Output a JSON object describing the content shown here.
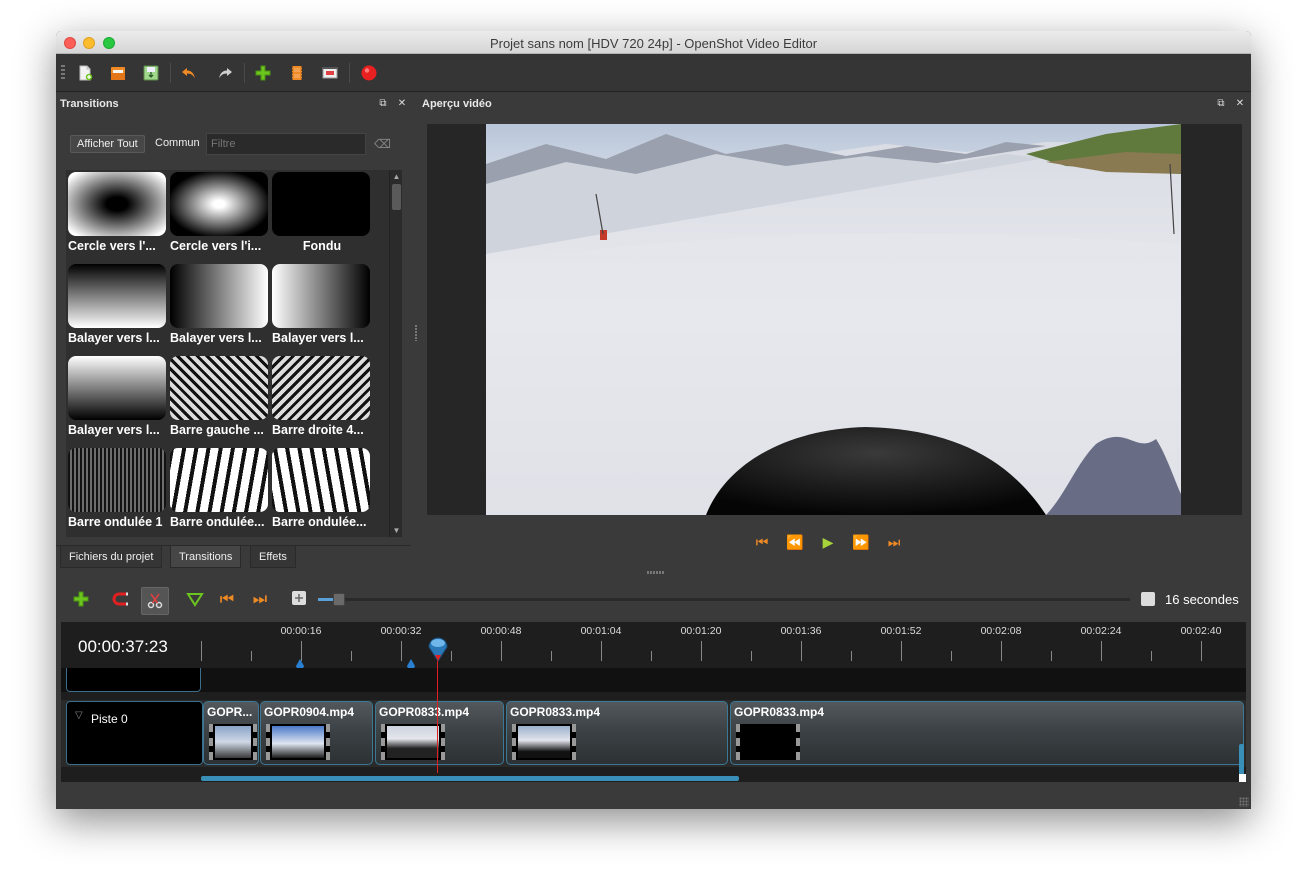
{
  "window": {
    "title": "Projet sans nom [HDV 720 24p] - OpenShot Video Editor"
  },
  "toolbar": {
    "icons": [
      "new-project-icon",
      "open-project-icon",
      "save-project-icon",
      "undo-icon",
      "redo-icon",
      "import-files-icon",
      "profile-icon",
      "fullscreen-icon",
      "export-video-icon"
    ]
  },
  "transitions_panel": {
    "title": "Transitions",
    "filter_show_all": "Afficher Tout",
    "filter_common": "Commun",
    "filter_placeholder": "Filtre",
    "items": [
      "Cercle vers l'...",
      "Cercle vers l'i...",
      "Fondu",
      "Balayer vers l...",
      "Balayer vers l...",
      "Balayer vers l...",
      "Balayer vers l...",
      "Barre gauche ...",
      "Barre droite 4...",
      "Barre ondulée 1",
      "Barre ondulée...",
      "Barre ondulée..."
    ]
  },
  "tabs": {
    "project_files": "Fichiers du projet",
    "transitions": "Transitions",
    "effects": "Effets"
  },
  "preview_panel": {
    "title": "Aperçu vidéo"
  },
  "timeline": {
    "current_time": "00:00:37:23",
    "zoom_label": "16 secondes",
    "ruler_labels": [
      "00:00:16",
      "00:00:32",
      "00:00:48",
      "00:01:04",
      "00:01:20",
      "00:01:36",
      "00:01:52",
      "00:02:08",
      "00:02:24",
      "00:02:40"
    ],
    "track_name": "Piste 0",
    "clips": [
      "GOPR...",
      "GOPR0904.mp4",
      "GOPR0833.mp4",
      "GOPR0833.mp4",
      "GOPR0833.mp4"
    ]
  },
  "colors": {
    "accent_blue": "#3a8fb8",
    "playhead_red": "#e02020",
    "orange_icon": "#f08a24",
    "green_icon": "#6cc51e"
  }
}
